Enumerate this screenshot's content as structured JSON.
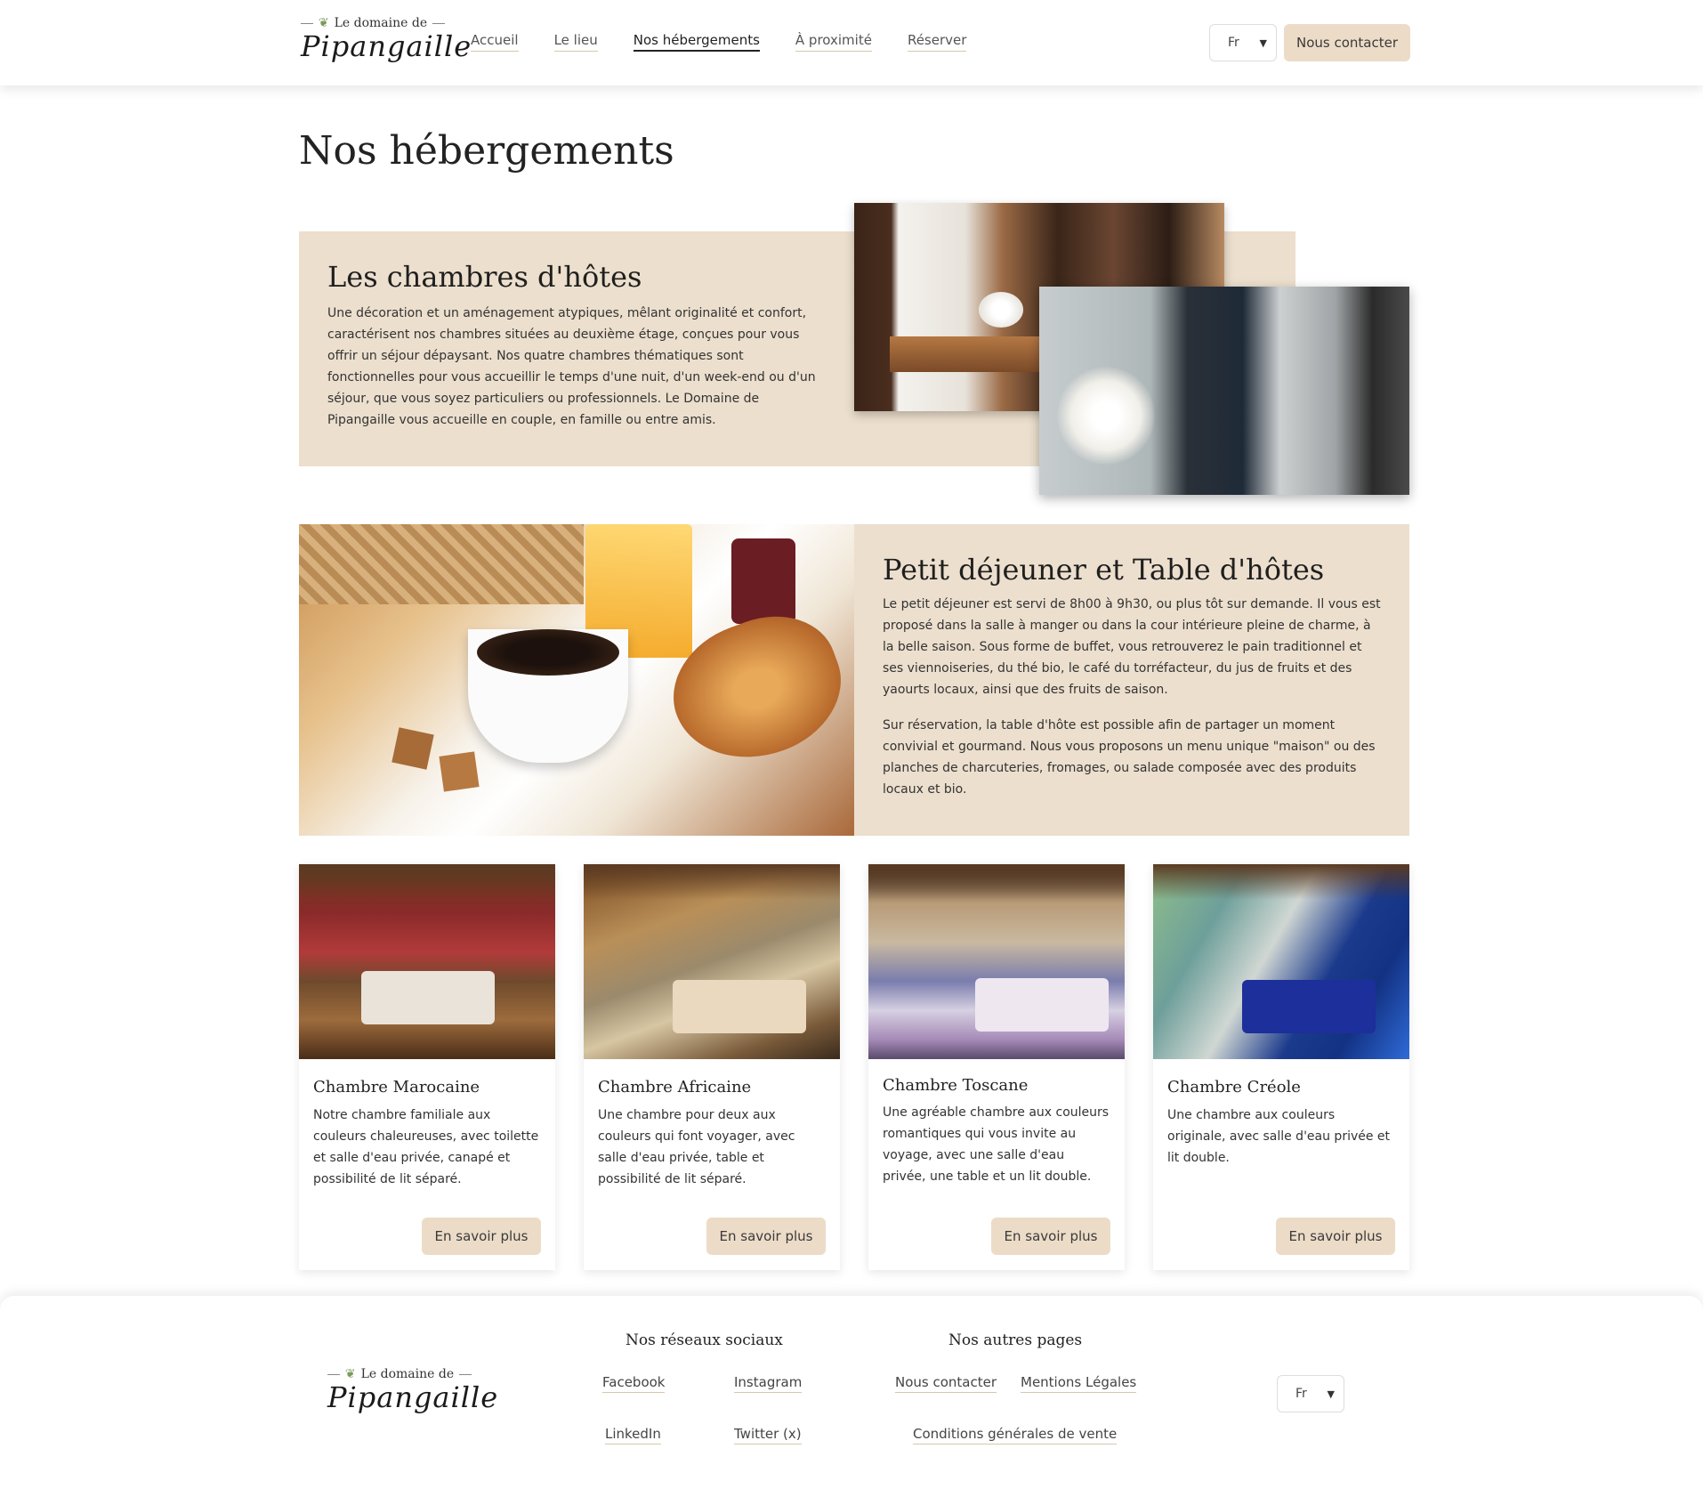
{
  "logo": {
    "top_text": "Le domaine de",
    "script_text": "Pipangaille"
  },
  "nav": {
    "items": [
      {
        "label": "Accueil"
      },
      {
        "label": "Le lieu"
      },
      {
        "label": "Nos hébergements"
      },
      {
        "label": "À proximité"
      },
      {
        "label": "Réserver"
      }
    ],
    "active_item": "Nos hébergements"
  },
  "header": {
    "language": "Fr",
    "contact_label": "Nous contacter"
  },
  "page": {
    "title": "Nos hébergements"
  },
  "section_rooms": {
    "title": "Les chambres d'hôtes",
    "text": "Une décoration et un aménagement atypiques, mêlant originalité et confort, caractérisent nos chambres situées au deuxième étage, conçues pour vous offrir un séjour dépaysant. Nos quatre chambres thématiques sont fonctionnelles pour vous accueillir le temps d'une nuit, d'un week-end ou d'un séjour, que vous soyez particuliers ou professionnels. Le Domaine de Pipangaille vous accueille en couple, en famille ou entre amis."
  },
  "section_breakfast": {
    "title": "Petit déjeuner et Table d'hôtes",
    "text1": "Le petit déjeuner est servi de 8h00 à 9h30, ou plus tôt sur demande. Il vous est proposé dans la salle à manger ou dans la cour intérieure pleine de charme, à la belle saison. Sous forme de buffet, vous retrouverez le pain traditionnel et ses viennoiseries, du thé bio, le café du torréfacteur, du jus de fruits et des yaourts locaux, ainsi que des fruits de saison.",
    "text2": "Sur réservation, la table d'hôte est possible afin de partager un moment convivial et gourmand. Nous vous proposons un menu unique \"maison\" ou des planches de charcuteries, fromages, ou salade composée avec des produits locaux et bio."
  },
  "cards": [
    {
      "title": "Chambre Marocaine",
      "text": "Notre chambre familiale aux couleurs chaleureuses, avec toilette et salle d'eau privée, canapé et possibilité de lit séparé.",
      "button": "En savoir plus"
    },
    {
      "title": "Chambre Africaine",
      "text": "Une chambre pour deux aux couleurs qui font voyager, avec salle d'eau privée, table et possibilité de lit séparé.",
      "button": "En savoir plus"
    },
    {
      "title": "Chambre Toscane",
      "text": "Une agréable chambre aux couleurs romantiques qui vous invite au voyage, avec une salle d'eau privée, une table et un lit double.",
      "button": "En savoir plus"
    },
    {
      "title": "Chambre Créole",
      "text": "Une chambre aux couleurs originale, avec salle d'eau privée et lit double.",
      "button": "En savoir plus"
    }
  ],
  "footer": {
    "social_heading": "Nos réseaux sociaux",
    "pages_heading": "Nos autres pages",
    "social_links": [
      "Facebook",
      "Instagram",
      "LinkedIn",
      "Twitter (x)"
    ],
    "page_links": [
      "Nous contacter",
      "Mentions Légales",
      "Conditions générales de vente"
    ],
    "language": "Fr"
  },
  "colors": {
    "accent_beige": "#ecdcc7",
    "panel_beige": "#ecdfcd",
    "text_dark": "#222222"
  },
  "icons": [
    "sprig-icon",
    "chevron-down-icon"
  ]
}
